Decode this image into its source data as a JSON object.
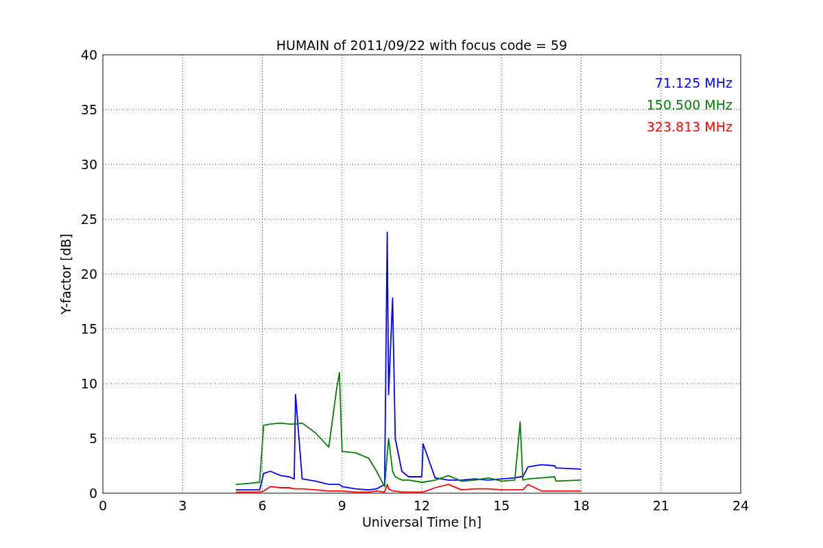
{
  "figure": {
    "chart_data": {
      "type": "line",
      "title": "HUMAIN of 2011/09/22 with focus code = 59",
      "xlabel": "Universal Time [h]",
      "ylabel": "Y-factor [dB]",
      "x": [
        5,
        5.5,
        5.9,
        6.05,
        6.3,
        6.7,
        7.0,
        7.2,
        7.25,
        7.5,
        8,
        8.5,
        8.8,
        8.9,
        9,
        9.5,
        10,
        10.3,
        10.6,
        10.7,
        10.75,
        10.9,
        11,
        11.25,
        11.5,
        12,
        12.05,
        12.5,
        13,
        13.5,
        14,
        14.5,
        15,
        15.5,
        15.7,
        15.8,
        16,
        16.5,
        17,
        17.05,
        18
      ],
      "series": [
        {
          "name": "71.125 MHz",
          "color": "#0000ff",
          "values": [
            0.3,
            0.3,
            0.3,
            1.8,
            2.0,
            1.6,
            1.5,
            1.3,
            9,
            1.3,
            1.1,
            0.8,
            0.8,
            0.8,
            0.6,
            0.4,
            0.3,
            0.4,
            0.8,
            23.8,
            9,
            17.8,
            5,
            2,
            1.5,
            1.5,
            4.5,
            1.4,
            1.2,
            1.2,
            1.3,
            1.2,
            1.3,
            1.4,
            1.5,
            1.5,
            2.4,
            2.6,
            2.5,
            2.3,
            2.2
          ]
        },
        {
          "name": "150.500 MHz",
          "color": "#008000",
          "values": [
            0.8,
            0.9,
            1.0,
            6.2,
            6.3,
            6.4,
            6.3,
            6.3,
            6.3,
            6.4,
            5.5,
            4.2,
            9.6,
            11,
            3.8,
            3.7,
            3.2,
            2.0,
            0.6,
            3.5,
            5,
            2,
            1.5,
            1.2,
            1.2,
            1.0,
            1.0,
            1.2,
            1.6,
            1.1,
            1.2,
            1.4,
            1.1,
            1.2,
            6.5,
            1.2,
            1.3,
            1.4,
            1.5,
            1.1,
            1.2
          ]
        },
        {
          "name": "323.813 MHz",
          "color": "#ff0000",
          "values": [
            0.1,
            0.1,
            0.1,
            0.2,
            0.6,
            0.5,
            0.5,
            0.4,
            0.4,
            0.4,
            0.3,
            0.2,
            0.2,
            0.2,
            0.2,
            0.1,
            0.1,
            0.2,
            0.1,
            0.8,
            0.4,
            0.2,
            0.2,
            0.1,
            0.1,
            0.1,
            0.1,
            0.5,
            0.8,
            0.3,
            0.4,
            0.4,
            0.3,
            0.3,
            0.3,
            0.3,
            0.8,
            0.2,
            0.2,
            0.2,
            0.2
          ]
        }
      ],
      "xlim": [
        0,
        24
      ],
      "ylim": [
        0,
        40
      ],
      "xticks": [
        0,
        3,
        6,
        9,
        12,
        15,
        18,
        21,
        24
      ],
      "yticks": [
        0,
        5,
        10,
        15,
        20,
        25,
        30,
        35,
        40
      ],
      "grid": true
    }
  }
}
